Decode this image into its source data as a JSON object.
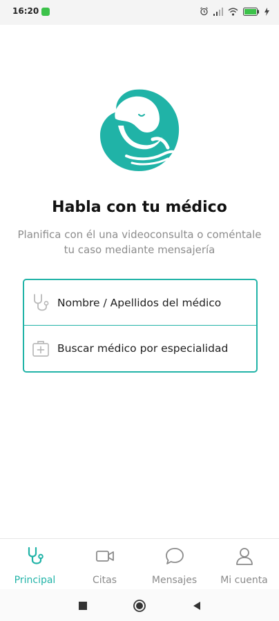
{
  "status_bar": {
    "time": "16:20",
    "app_icon_color": "#3cc24a",
    "icons": [
      "alarm-icon",
      "signal-icon",
      "wifi-icon",
      "battery-icon",
      "charging-icon"
    ],
    "battery_level": "100"
  },
  "brand": {
    "accent_color": "#20b3a7",
    "logo_icon": "baby-in-hands-logo"
  },
  "main": {
    "title": "Habla con tu médico",
    "subtitle": "Planifica con él una videoconsulta o coméntale tu caso mediante mensajería"
  },
  "search": {
    "by_name_label": "Nombre / Apellidos del médico",
    "by_name_icon": "stethoscope-icon",
    "by_specialty_label": "Buscar médico por especialidad",
    "by_specialty_icon": "medical-kit-icon"
  },
  "bottom_nav": {
    "active": "Principal",
    "tabs": [
      {
        "label": "Principal",
        "icon": "stethoscope-icon"
      },
      {
        "label": "Citas",
        "icon": "video-camera-icon"
      },
      {
        "label": "Mensajes",
        "icon": "chat-bubble-icon"
      },
      {
        "label": "Mi cuenta",
        "icon": "user-icon"
      }
    ]
  },
  "system_nav": [
    "recents-square-icon",
    "home-circle-icon",
    "back-triangle-icon"
  ]
}
